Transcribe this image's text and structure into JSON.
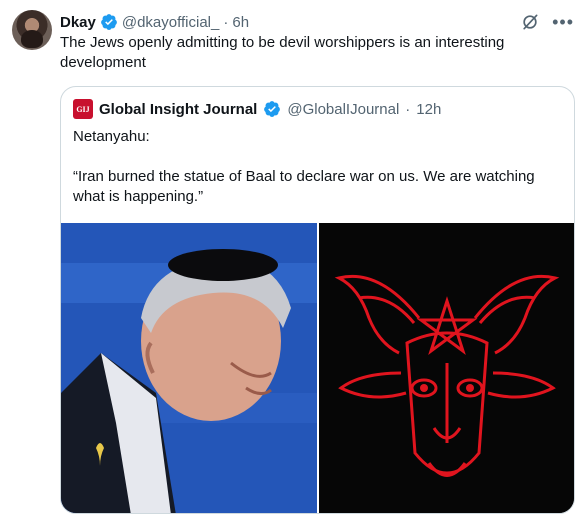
{
  "tweet": {
    "display_name": "Dkay",
    "handle": "@dkayofficial_",
    "separator": "·",
    "time": "6h",
    "text": "The Jews openly admitting to be devil worshippers is an interesting development"
  },
  "quote": {
    "logo_text": "GIJ",
    "display_name": "Global Insight Journal",
    "handle": "@GlobalIJournal",
    "separator": "·",
    "time": "12h",
    "paragraph_1": "Netanyahu:",
    "paragraph_2": "“Iran burned the statue of Baal to declare war on us. We are watching what is happening.”"
  },
  "colors": {
    "verified_blue": "#1d9bf0",
    "logo_red": "#c8102e",
    "pentagram_red": "#e0141e"
  },
  "icons": [
    "verified-badge-icon",
    "grok-icon",
    "more-options-icon"
  ]
}
